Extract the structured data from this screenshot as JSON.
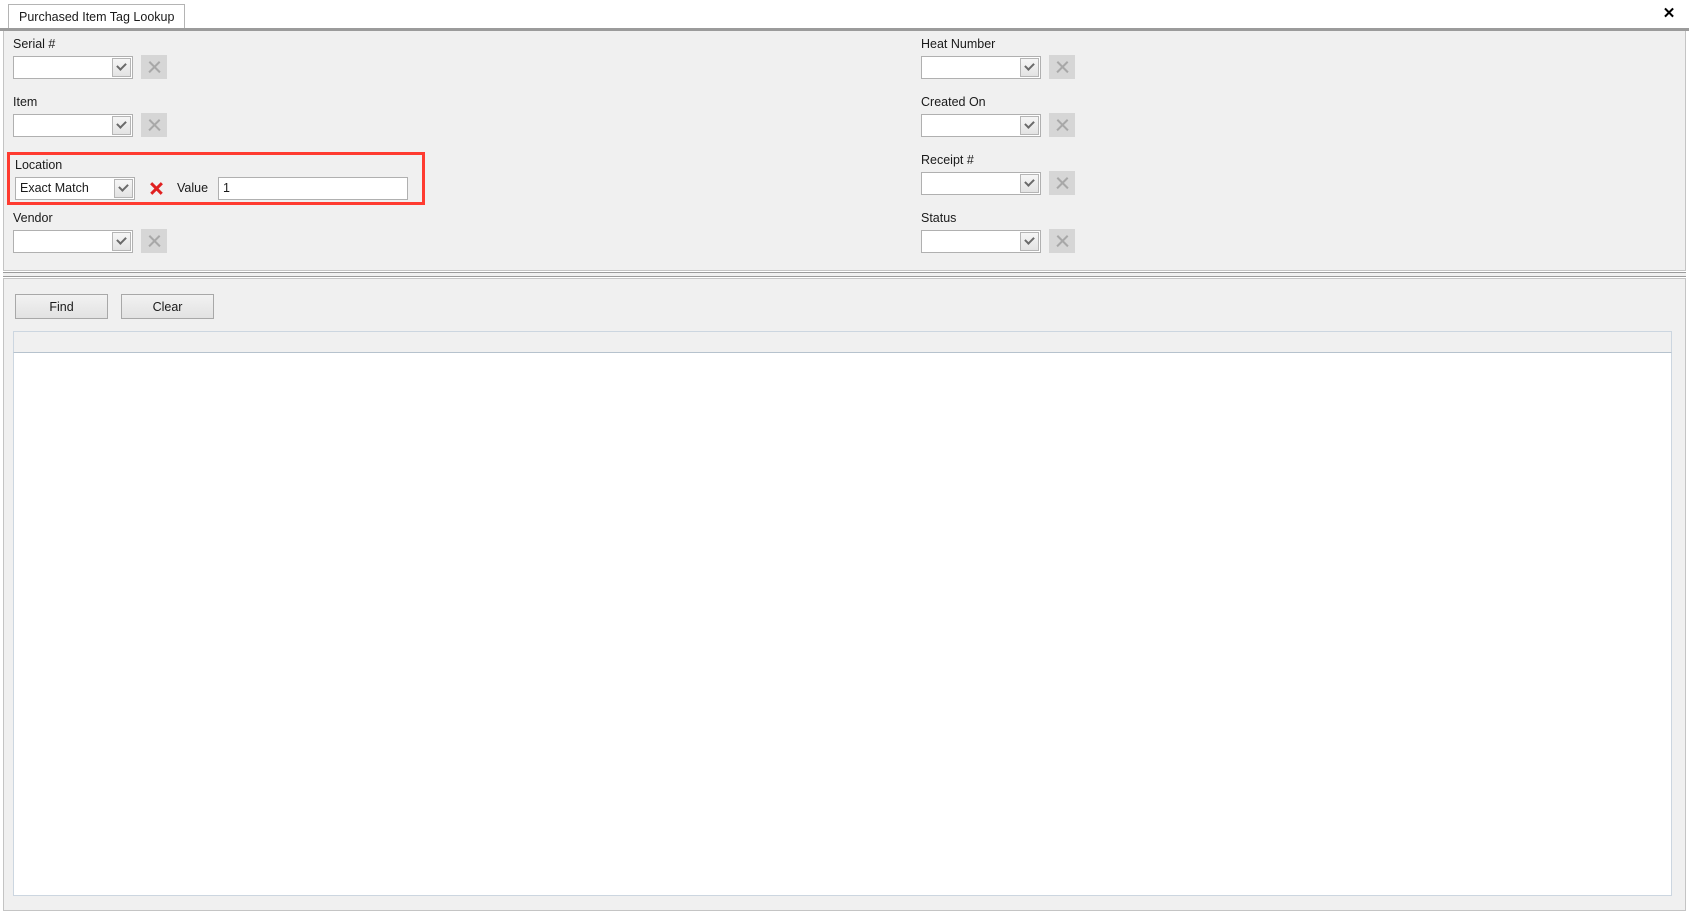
{
  "window": {
    "close_label": "✕"
  },
  "tabs": [
    {
      "label": "Purchased Item Tag Lookup",
      "active": true
    }
  ],
  "criteria": {
    "left_fields": [
      {
        "label": "Serial #",
        "value": "",
        "clear_enabled": false
      },
      {
        "label": "Item",
        "value": "",
        "clear_enabled": false
      },
      {
        "label": "Vendor",
        "value": "",
        "clear_enabled": false
      }
    ],
    "right_fields": [
      {
        "label": "Heat Number",
        "value": "",
        "clear_enabled": false
      },
      {
        "label": "Created On",
        "value": "",
        "clear_enabled": false
      },
      {
        "label": "Receipt #",
        "value": "",
        "clear_enabled": false
      },
      {
        "label": "Status",
        "value": "",
        "clear_enabled": false
      }
    ],
    "location": {
      "label": "Location",
      "operator": "Exact Match",
      "value_label": "Value",
      "value": "1",
      "highlight_color": "#ff3b30",
      "clear_color": "#e02020",
      "clear_enabled": true
    }
  },
  "actions": {
    "find_label": "Find",
    "clear_label": "Clear"
  },
  "results": {
    "columns": [],
    "rows": [],
    "row_count": 0
  }
}
